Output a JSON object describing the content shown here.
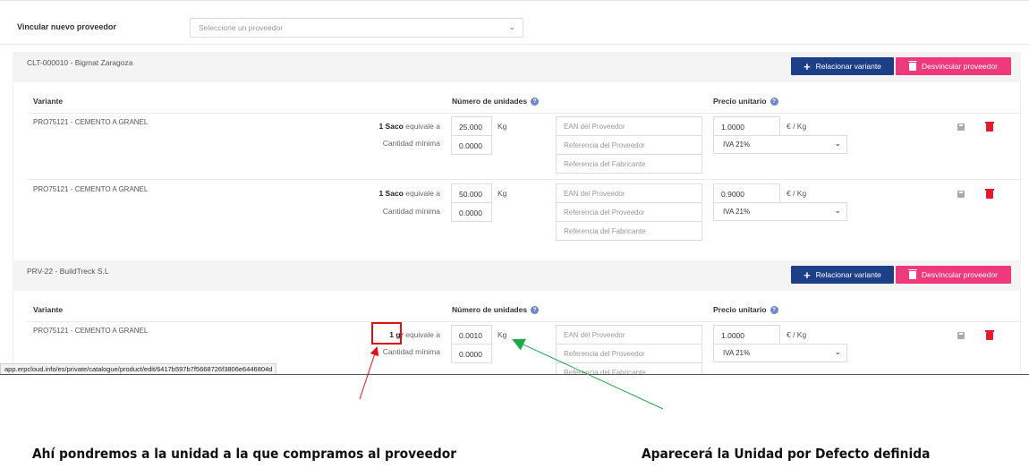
{
  "link_supplier": {
    "label": "Vincular nuevo proveedor",
    "placeholder": "Seleccione un proveedor"
  },
  "columns": {
    "variant": "Variante",
    "units": "Número de unidades",
    "price": "Precio unitario"
  },
  "buttons": {
    "relate": "Relacionar variante",
    "unlink": "Desvincular proveedor"
  },
  "common": {
    "equivale": "equivale a",
    "min_qty": "Cantidad mínima",
    "ean_ph": "EAN del Proveedor",
    "ref_prov_ph": "Referencia del Proveedor",
    "ref_fab_ph": "Referencia del Fabricante",
    "unit": "Kg",
    "price_unit": "€ / Kg"
  },
  "suppliers": [
    {
      "name": "CLT-000010 - Bigmat Zaragoza",
      "rows": [
        {
          "variant": "PRO75121 - CEMENTO A GRANEL",
          "pack_unit": "1 Saco",
          "qty": "25.000",
          "min": "0.0000",
          "price": "1.0000",
          "iva": "IVA 21%"
        },
        {
          "variant": "PRO75121 - CEMENTO A GRANEL",
          "pack_unit": "1 Saco",
          "qty": "50.000",
          "min": "0.0000",
          "price": "0.9000",
          "iva": "IVA 21%"
        }
      ]
    },
    {
      "name": "PRV-22 - BuildTreck S.L",
      "rows": [
        {
          "variant": "PRO75121 - CEMENTO A GRANEL",
          "pack_unit": "1 gr",
          "qty": "0.0010",
          "min": "0.0000",
          "price": "1.0000",
          "iva": "IVA 21%"
        }
      ]
    }
  ],
  "status_url": "app.erpcloud.info/es/private/catalogue/product/edit/6417b597b7f5668726f3806e6446804d",
  "captions": {
    "left": "Ahí pondremos a la unidad a la que compramos al proveedor",
    "right": "Aparecerá la Unidad por Defecto definida"
  },
  "colors": {
    "primary_button": "#1c3f87",
    "danger_button": "#f0397a",
    "delete_icon": "#e21b2b",
    "annotation_red": "#e01010",
    "annotation_green": "#1fa84a"
  },
  "icons": [
    "chevron-down-icon",
    "plus-icon",
    "trash-icon",
    "help-icon",
    "save-icon"
  ]
}
